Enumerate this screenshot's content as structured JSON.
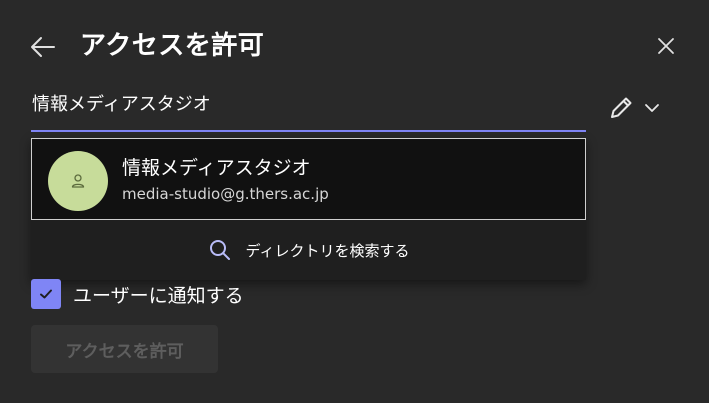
{
  "dialog": {
    "title": "アクセスを許可"
  },
  "search": {
    "value": "情報メディアスタジオ"
  },
  "suggestion": {
    "name": "情報メディアスタジオ",
    "email": "media-studio@g.thers.ac.jp",
    "avatar_color": "#c7dc9a"
  },
  "directory": {
    "label": "ディレクトリを検索する"
  },
  "notify": {
    "label": "ユーザーに通知する",
    "checked": true
  },
  "grant_button": {
    "label": "アクセスを許可",
    "disabled": true
  },
  "colors": {
    "background": "#292929",
    "accent": "#7f85f5",
    "dropdown": "#1f1f1f"
  },
  "icons": {
    "back": "arrow-left-icon",
    "close": "close-icon",
    "permission": "pencil-icon",
    "expand": "chevron-down-icon",
    "avatar": "person-icon",
    "directory": "search-icon",
    "checkbox": "checkmark-icon"
  }
}
